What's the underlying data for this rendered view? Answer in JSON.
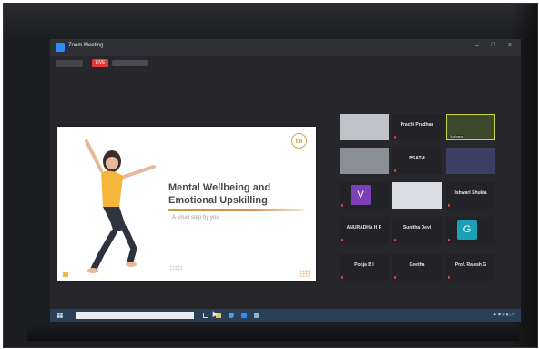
{
  "window": {
    "title": "Zoom Meeting"
  },
  "toolbar": {
    "live_label": "LIVE"
  },
  "slide": {
    "title_line1": "Mental Wellbeing and",
    "title_line2": "Emotional Upskilling",
    "subtitle": "A small step by you",
    "logo_letter": "m"
  },
  "participants": [
    {
      "name": "Prachi Pradhan",
      "caption": ""
    },
    {
      "name": "",
      "caption": ""
    },
    {
      "name": "",
      "caption": "Sadhana"
    },
    {
      "name": "BSATM",
      "caption": ""
    },
    {
      "name": "",
      "caption": ""
    },
    {
      "name": "",
      "caption": ""
    },
    {
      "name": "Ishwarl Shukla",
      "caption": ""
    },
    {
      "name": "ANURADHA H R",
      "caption": ""
    },
    {
      "name": "Sunitha Devi",
      "caption": ""
    },
    {
      "name": "",
      "caption": ""
    },
    {
      "name": "Pooja B I",
      "caption": ""
    },
    {
      "name": "Geetha",
      "caption": ""
    },
    {
      "name": "Prof. Rajesh G",
      "caption": ""
    }
  ],
  "avatars": {
    "v_letter": "V",
    "g_letter": "G"
  },
  "colors": {
    "accent_gold": "#d4a83a",
    "live_red": "#e03a3a",
    "zoom_blue": "#2d8cff",
    "avatar_v": "#7b3fb6",
    "avatar_g": "#1aa1b8"
  },
  "icons": [
    "zoom-logo-icon",
    "windows-start-icon",
    "mic-muted-icon",
    "cursor-icon"
  ]
}
